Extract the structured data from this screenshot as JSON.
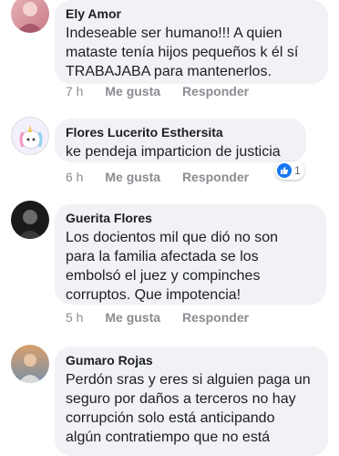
{
  "comments": [
    {
      "author": "Ely Amor",
      "lines": [
        "Indeseable ser humano!!! A quien",
        "mataste tenía hijos pequeños k él sí",
        "TRABAJABA para mantenerlos."
      ],
      "time": "7 h",
      "like_label": "Me gusta",
      "reply_label": "Responder",
      "avatar_icon": "avatar-photo"
    },
    {
      "author": "Flores Lucerito Esthersita",
      "lines": [
        "ke pendeja imparticion de justicia"
      ],
      "time": "6 h",
      "like_label": "Me gusta",
      "reply_label": "Responder",
      "reaction_count": "1",
      "avatar_icon": "avatar-unicorn"
    },
    {
      "author": "Guerita Flores",
      "lines": [
        "Los docientos mil que dió no son",
        "para la familia afectada se los",
        "embolsó el juez y compinches",
        "corruptos. Que impotencia!"
      ],
      "time": "5 h",
      "like_label": "Me gusta",
      "reply_label": "Responder",
      "avatar_icon": "avatar-photo"
    },
    {
      "author": "Gumaro Rojas",
      "lines": [
        "Perdón sras y eres si alguien paga un",
        "seguro por daños a terceros no hay",
        "corrupción solo está anticipando",
        "algún contratiempo que no está"
      ],
      "avatar_icon": "avatar-photo"
    }
  ],
  "colors": {
    "bubble": "#f0f2f5",
    "meta": "#8a8d91",
    "like_badge": "#1877f2"
  }
}
